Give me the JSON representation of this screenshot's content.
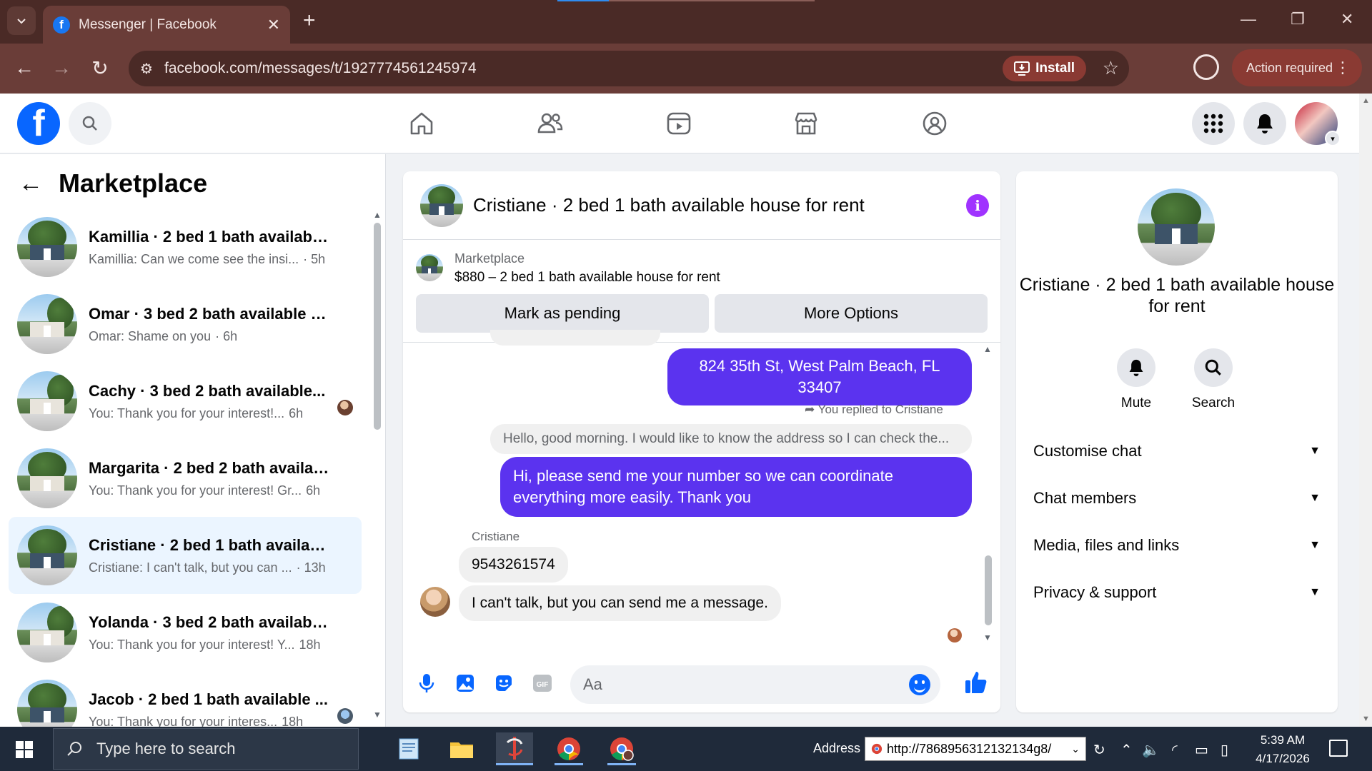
{
  "browser": {
    "tab_title": "Messenger | Facebook",
    "url": "facebook.com/messages/t/1927774561245974",
    "install_label": "Install",
    "action_required_label": "Action required"
  },
  "sidebar": {
    "title": "Marketplace",
    "conversations": [
      {
        "name": "Kamillia · 2 bed 1 bath available ...",
        "preview": "Kamillia: Can we come see the insi...",
        "time": "· 5h",
        "active": false
      },
      {
        "name": "Omar · 3 bed 2 bath available h...",
        "preview": "Omar: Shame on you",
        "time": "· 6h",
        "active": false
      },
      {
        "name": "Cachy · 3 bed 2 bath available...",
        "preview": "You: Thank you for your interest!...",
        "time": "6h",
        "active": false
      },
      {
        "name": "Margarita · 2 bed 2 bath availabl...",
        "preview": "You: Thank you for your interest! Gr...",
        "time": "6h",
        "active": false
      },
      {
        "name": "Cristiane · 2 bed 1 bath available...",
        "preview": "Cristiane: I can't talk, but you can ...",
        "time": "· 13h",
        "active": true
      },
      {
        "name": "Yolanda · 3 bed 2 bath available ...",
        "preview": "You: Thank you for your interest! Y...",
        "time": "18h",
        "active": false
      },
      {
        "name": "Jacob · 2 bed 1 bath available ...",
        "preview": "You: Thank you for your interes...",
        "time": "18h",
        "active": false
      }
    ]
  },
  "chat": {
    "title": "Cristiane · 2 bed 1 bath available house for rent",
    "marketplace_label": "Marketplace",
    "listing": "$880 – 2 bed 1 bath available house for rent",
    "mark_pending_label": "Mark as pending",
    "more_options_label": "More Options",
    "messages": {
      "address": "824 35th St, West Palm Beach, FL 33407",
      "reply_note": "You replied to Cristiane",
      "quoted": "Hello, good morning. I would like to know the address so I can check the...",
      "outgoing": "Hi, please send me your number so we can coordinate everything more easily. Thank you",
      "sender": "Cristiane",
      "incoming_1": "9543261574",
      "incoming_2": "I can't talk, but you can send me a message."
    },
    "composer_placeholder": "Aa"
  },
  "info_panel": {
    "title": "Cristiane · 2 bed 1 bath available house for rent",
    "mute_label": "Mute",
    "search_label": "Search",
    "sections": [
      "Customise chat",
      "Chat members",
      "Media, files and links",
      "Privacy & support"
    ]
  },
  "taskbar": {
    "search_placeholder": "Type here to search",
    "address_label": "Address",
    "address_value": "http://7868956312132134g8/",
    "time": "5:39 AM",
    "date": "4/17/2026"
  },
  "colors": {
    "fb_blue": "#0866ff",
    "outgoing_bubble": "#5b33ef",
    "info_icon": "#a033ff",
    "browser_frame": "#6a3d38"
  }
}
